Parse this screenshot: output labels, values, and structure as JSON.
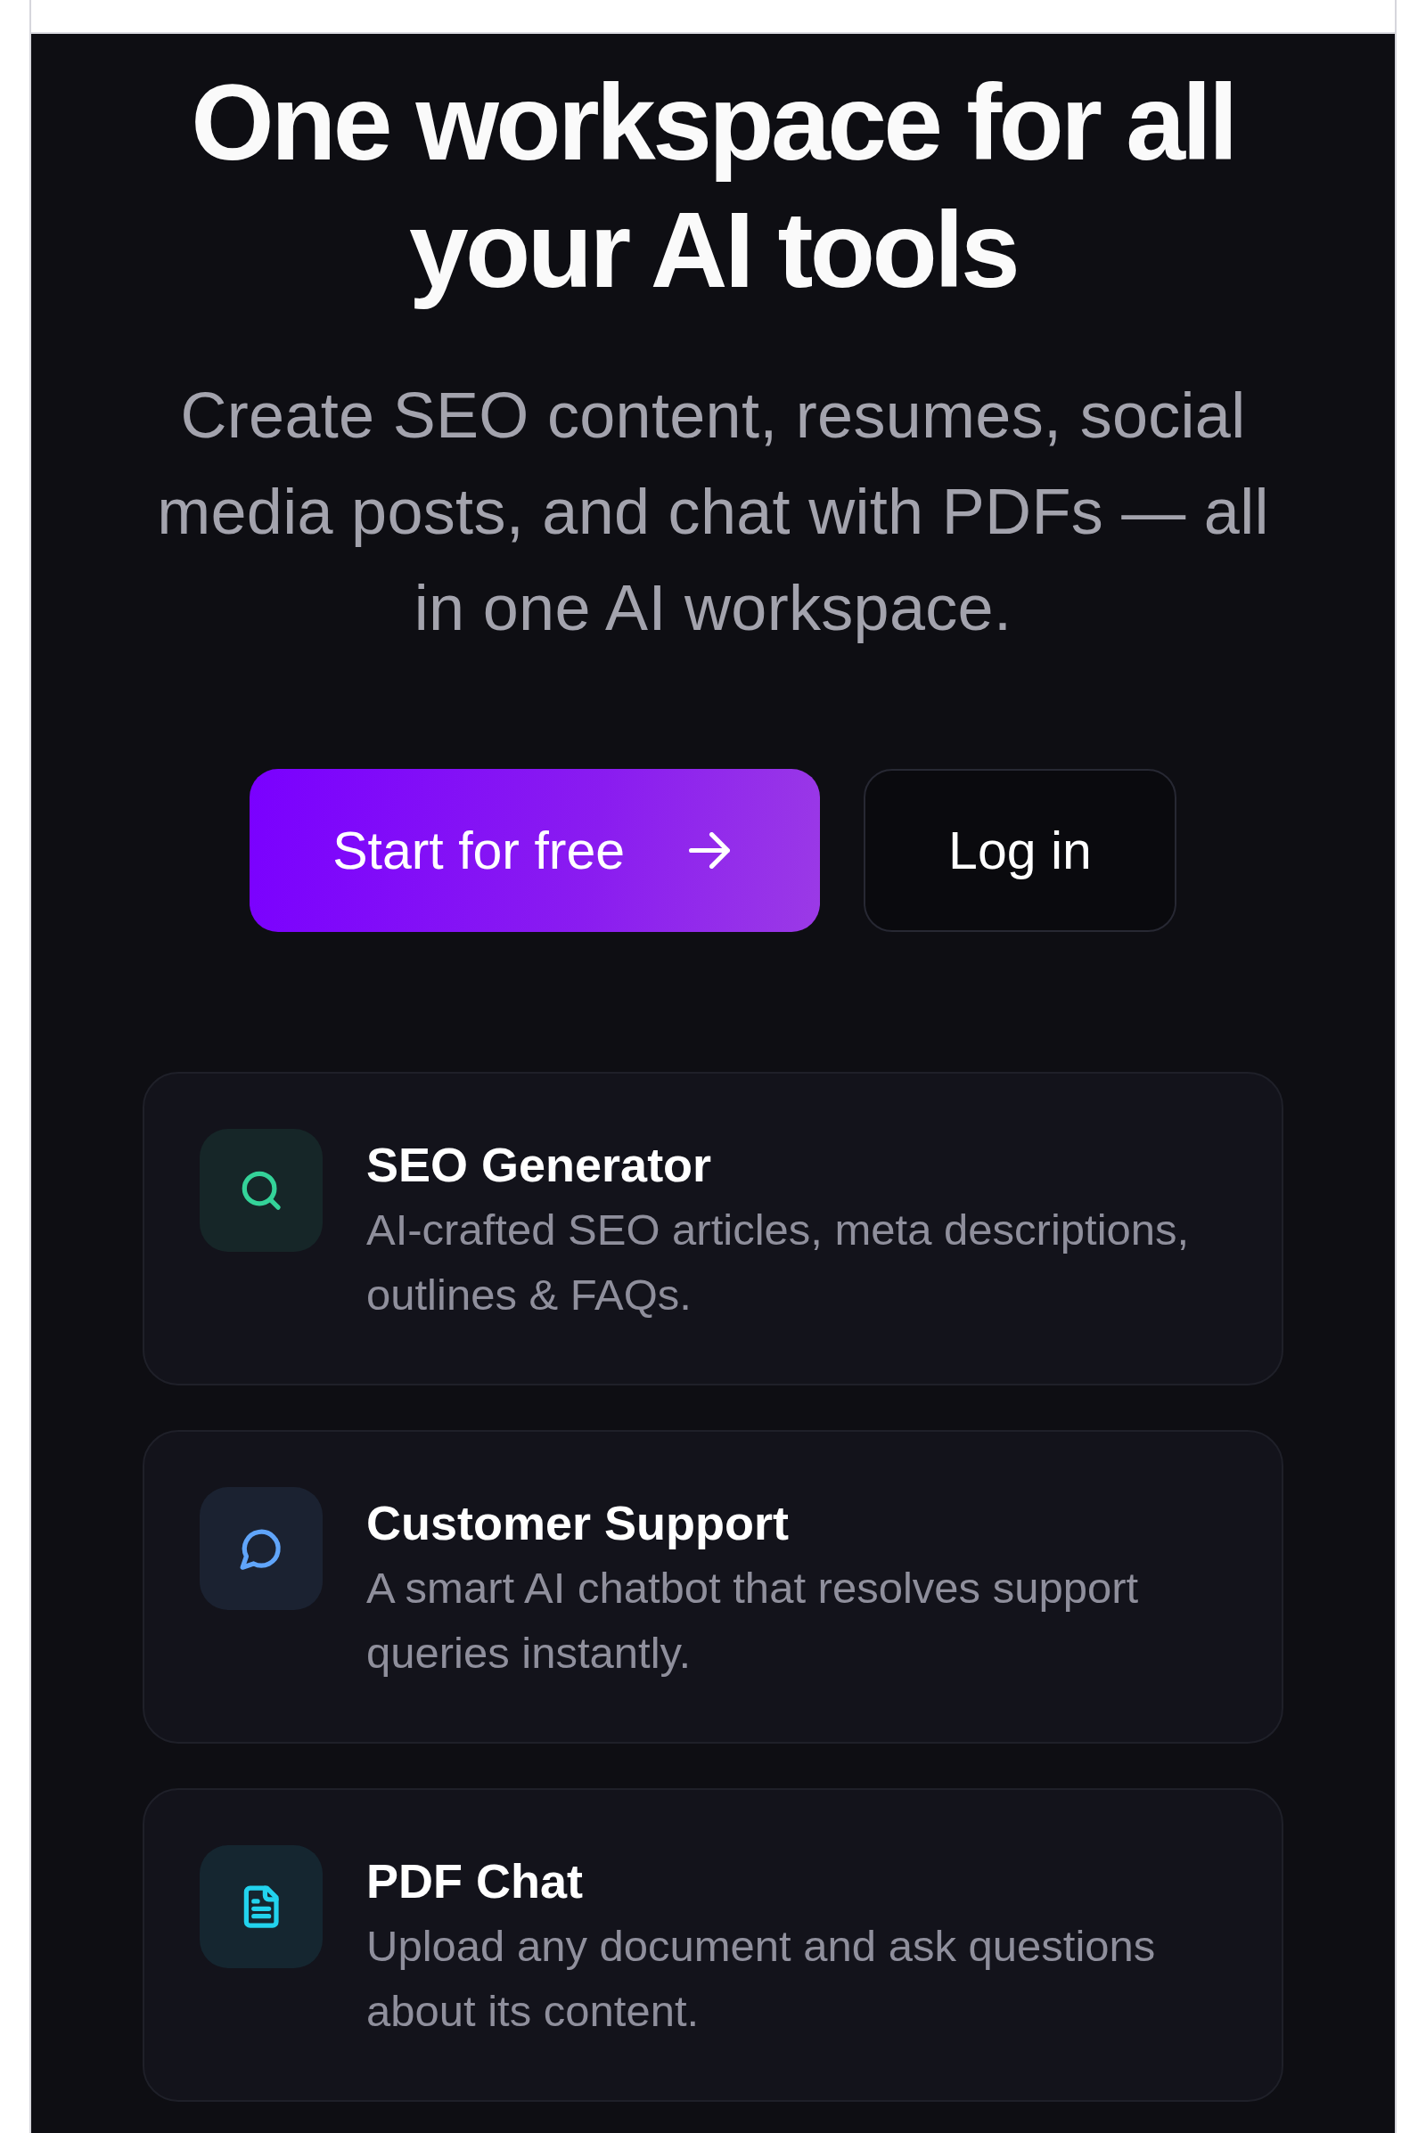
{
  "hero": {
    "title": "One workspace for all your AI tools",
    "subtitle": "Create SEO content, resumes, social media posts, and chat with PDFs — all in one AI workspace.",
    "actions": [
      {
        "label": "Start for free",
        "kind": "primary"
      },
      {
        "label": "Log in",
        "kind": "secondary"
      }
    ]
  },
  "features": [
    {
      "kind": "search",
      "title": "SEO Generator",
      "description": "AI-crafted SEO articles, meta descriptions, outlines & FAQs.",
      "color": "#34d399"
    },
    {
      "kind": "chat",
      "title": "Customer Support",
      "description": "A smart AI chatbot that resolves support queries instantly.",
      "color": "#60a5fa"
    },
    {
      "kind": "document",
      "title": "PDF Chat",
      "description": "Upload any document and ask questions about its content.",
      "color": "#22d3ee"
    }
  ]
}
